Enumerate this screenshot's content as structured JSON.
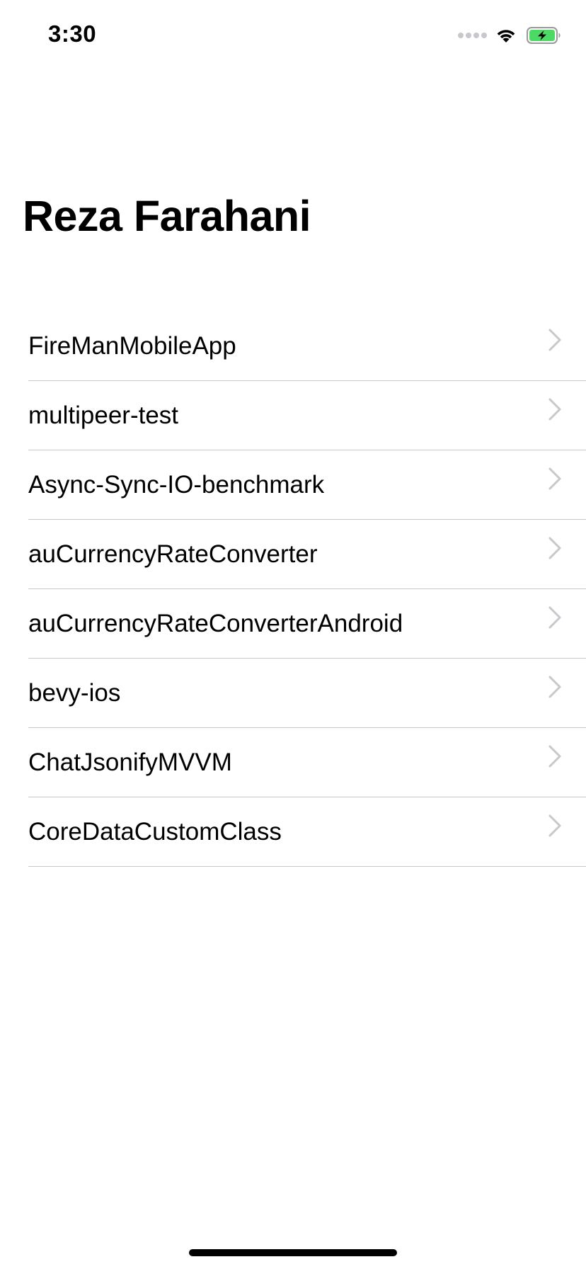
{
  "status_bar": {
    "time": "3:30",
    "icons": [
      "cellular-signal-icon",
      "wifi-icon",
      "battery-charging-icon"
    ],
    "battery_color": "#4cd964"
  },
  "page": {
    "title": "Reza Farahani"
  },
  "repo_list": {
    "items": [
      {
        "label": "FireManMobileApp"
      },
      {
        "label": "multipeer-test"
      },
      {
        "label": "Async-Sync-IO-benchmark"
      },
      {
        "label": "auCurrencyRateConverter"
      },
      {
        "label": "auCurrencyRateConverterAndroid"
      },
      {
        "label": "bevy-ios"
      },
      {
        "label": "ChatJsonifyMVVM"
      },
      {
        "label": "CoreDataCustomClass"
      }
    ],
    "accessory_icon": "chevron-right-icon"
  },
  "colors": {
    "separator": "#c8c7cc",
    "chevron": "#c7c7cc"
  }
}
